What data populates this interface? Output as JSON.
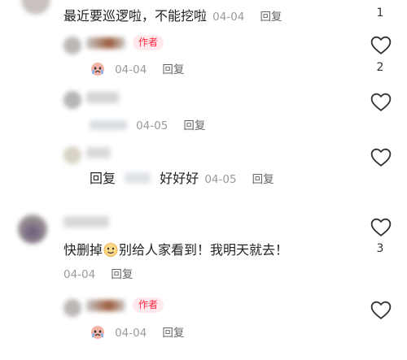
{
  "comment1": {
    "text": "最近要巡逻啦，不能挖啦",
    "date": "04-04",
    "reply_label": "回复",
    "like_count": "1",
    "reply1": {
      "badge": "作者",
      "date": "04-04",
      "reply_label": "回复",
      "like_count": "2"
    },
    "reply2": {
      "date": "04-05",
      "reply_label": "回复"
    },
    "reply3": {
      "prefix": "回复",
      "text": "好好好",
      "date": "04-05",
      "reply_label": "回复"
    }
  },
  "comment2": {
    "text_before": "快删掉",
    "text_after": "别给人家看到！我明天就去！",
    "date": "04-04",
    "reply_label": "回复",
    "like_count": "3",
    "reply1": {
      "badge": "作者",
      "date": "04-04",
      "reply_label": "回复"
    }
  },
  "colors": {
    "accent": "#ff2442",
    "badge_bg": "#ffe9ec",
    "muted": "#9a9a9a"
  },
  "icons": [
    "heart-outline-icon",
    "crying-face-emoji",
    "smile-emoji"
  ]
}
